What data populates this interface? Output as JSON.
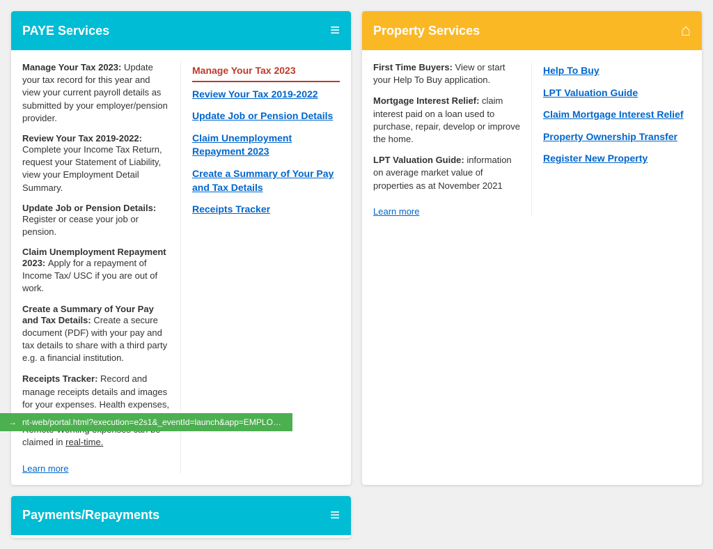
{
  "paye": {
    "header_title": "PAYE Services",
    "header_icon": "≡",
    "descriptions": [
      {
        "title": "Manage Your Tax 2023:",
        "text": "Update your tax record for this year and view your current payroll details as submitted by your employer/pension provider."
      },
      {
        "title": "Review Your Tax 2019-2022:",
        "text": "Complete your Income Tax Return, request your Statement of Liability, view your Employment Detail Summary."
      },
      {
        "title": "Update Job or Pension Details:",
        "text": "Register or cease your job or pension."
      },
      {
        "title": "Claim Unemployment Repayment 2023:",
        "text": "Apply for a repayment of Income Tax/ USC if you are out of work."
      },
      {
        "title": "Create a Summary of Your Pay and Tax Details:",
        "text": "Create a secure document (PDF) with your pay and tax details to share with a third party e.g. a financial institution."
      },
      {
        "title": "Receipts Tracker:",
        "text": "Record and manage receipts details and images for your expenses. Health expenses, Nursing Home expenses and Remote Working expenses can be claimed in real-time."
      }
    ],
    "learn_more": "Learn more",
    "links": [
      {
        "label": "Manage Your Tax 2023",
        "active": true
      },
      {
        "label": "Review Your Tax 2019-2022",
        "active": false
      },
      {
        "label": "Update Job or Pension Details",
        "active": false
      },
      {
        "label": "Claim Unemployment Repayment 2023",
        "active": false
      },
      {
        "label": "Create a Summary of Your Pay and Tax Details",
        "active": false
      },
      {
        "label": "Receipts Tracker",
        "active": false
      }
    ]
  },
  "property": {
    "header_title": "Property Services",
    "header_icon": "⌂",
    "descriptions": [
      {
        "title": "First Time Buyers:",
        "text": "View or start your Help To Buy application."
      },
      {
        "title": "Mortgage Interest Relief:",
        "text": "claim interest paid on a loan used to purchase, repair, develop or improve the home."
      },
      {
        "title": "LPT Valuation Guide:",
        "text": "information on average market value of properties as at November 2021"
      }
    ],
    "learn_more": "Learn more",
    "links": [
      {
        "label": "Help To Buy",
        "active": false
      },
      {
        "label": "LPT Valuation Guide",
        "active": false
      },
      {
        "label": "Claim Mortgage Interest Relief",
        "active": false
      },
      {
        "label": "Property Ownership Transfer",
        "active": false
      },
      {
        "label": "Register New Property",
        "active": false
      }
    ]
  },
  "payments": {
    "header_title": "Payments/Repayments",
    "header_icon": "≡"
  },
  "status_bar": {
    "url": "nt-web/portal.html?execution=e2s1&_eventId=launch&app=EMPLOYMENTS_SERVICE",
    "icon": "→"
  }
}
